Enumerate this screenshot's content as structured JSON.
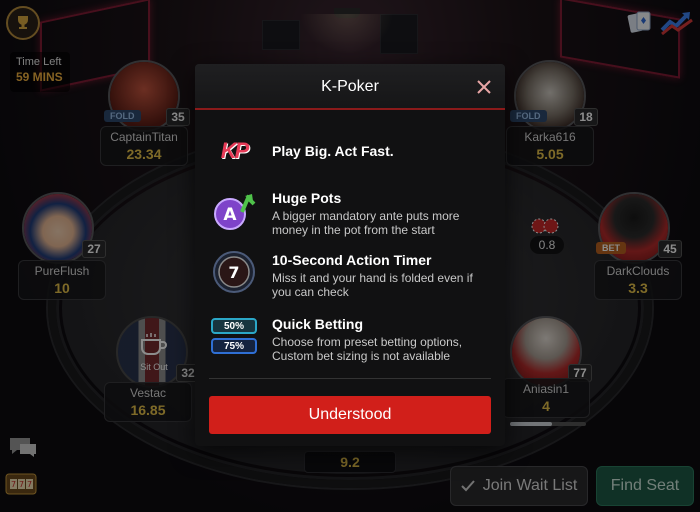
{
  "hud": {
    "time_left_label": "Time Left",
    "time_left_value": "59 MINS"
  },
  "players": [
    {
      "name": "CaptainTitan",
      "stack": "23.34",
      "seat_num": "35",
      "tag": "FOLD"
    },
    {
      "name": "Karka616",
      "stack": "5.05",
      "seat_num": "18",
      "tag": "FOLD"
    },
    {
      "name": "PureFlush",
      "stack": "10",
      "seat_num": "27",
      "tag": ""
    },
    {
      "name": "DarkClouds",
      "stack": "3.3",
      "seat_num": "45",
      "tag": "BET"
    },
    {
      "name": "Vestac",
      "stack": "16.85",
      "seat_num": "32",
      "tag": "Sit Out"
    },
    {
      "name": "Aniasin1",
      "stack": "4",
      "seat_num": "77",
      "tag": ""
    }
  ],
  "table": {
    "bet_amount": "0.8",
    "pot": "9.2"
  },
  "buttons": {
    "join_wait_list": "Join Wait List",
    "find_seat": "Find Seat"
  },
  "modal": {
    "title": "K-Poker",
    "logo_text": "KP",
    "features": [
      {
        "title": "Play Big. Act Fast.",
        "desc": ""
      },
      {
        "title": "Huge Pots",
        "desc": "A bigger mandatory ante puts more money in the pot from the start",
        "icon_letter": "A"
      },
      {
        "title": "10-Second Action Timer",
        "desc": "Miss it and your hand is folded even if you can check",
        "icon_number": "7"
      },
      {
        "title": "Quick Betting",
        "desc": "Choose from preset betting options, Custom bet sizing is not available",
        "presets": [
          "50%",
          "75%"
        ]
      }
    ],
    "confirm_label": "Understood"
  },
  "colors": {
    "accent_red": "#d11f1a",
    "gold": "#e6c14a",
    "find_seat_green": "#1e5a45"
  }
}
